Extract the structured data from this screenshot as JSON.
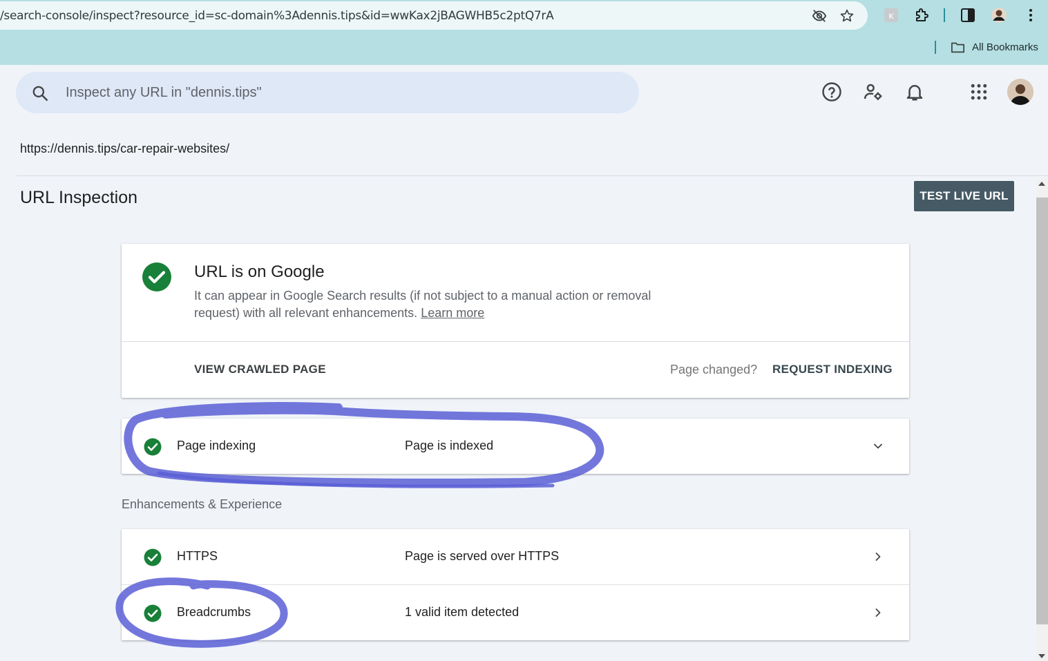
{
  "browser": {
    "address_url": "/search-console/inspect?resource_id=sc-domain%3Adennis.tips&id=wwKax2jBAGWHB5c2ptQ7rA",
    "bookmarks_label": "All Bookmarks"
  },
  "header": {
    "search_placeholder": "Inspect any URL in \"dennis.tips\""
  },
  "inspected_url": "https://dennis.tips/car-repair-websites/",
  "page_title": "URL Inspection",
  "test_live_label": "TEST LIVE URL",
  "status": {
    "title": "URL is on Google",
    "description": "It can appear in Google Search results (if not subject to a manual action or removal request) with all relevant enhancements.",
    "learn_more": "Learn more",
    "view_crawled_label": "VIEW CRAWLED PAGE",
    "page_changed_label": "Page changed?",
    "request_indexing_label": "REQUEST INDEXING"
  },
  "indexing": {
    "label": "Page indexing",
    "value": "Page is indexed"
  },
  "enhancements": {
    "section_label": "Enhancements & Experience",
    "rows": [
      {
        "label": "HTTPS",
        "value": "Page is served over HTTPS"
      },
      {
        "label": "Breadcrumbs",
        "value": "1 valid item detected"
      }
    ]
  },
  "colors": {
    "success_green": "#188038",
    "primary_button": "#455a64",
    "annotation_ink": "#5b5fd6"
  }
}
